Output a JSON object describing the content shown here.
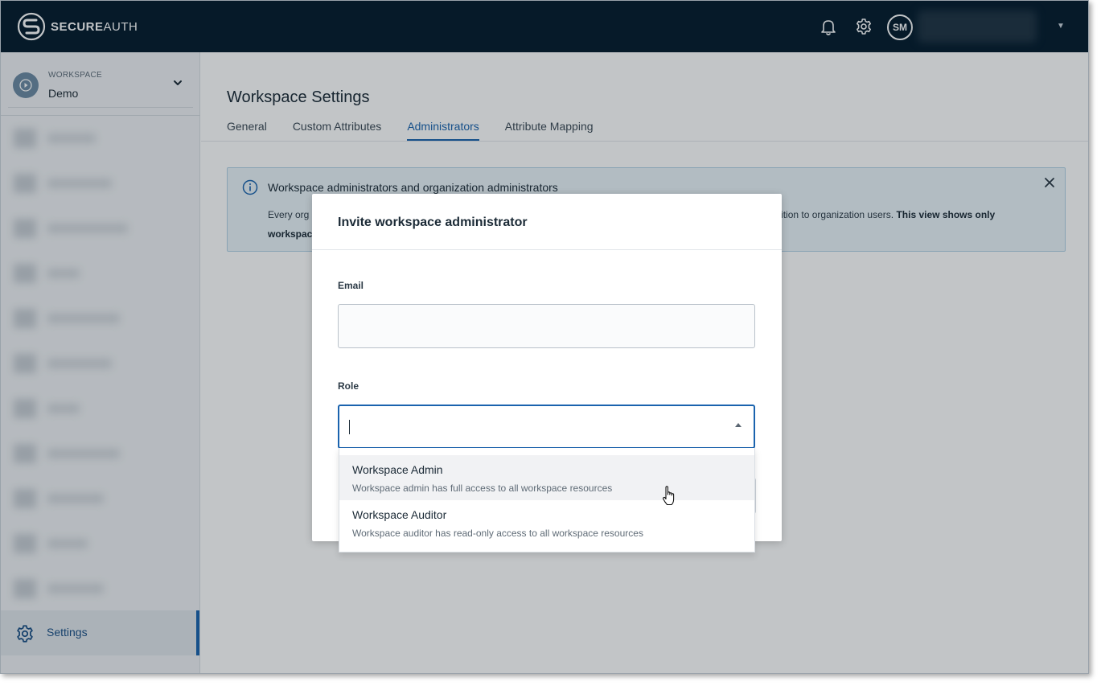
{
  "app": {
    "brand_bold": "SECURE",
    "brand_light": "AUTH",
    "avatar_initials": "SM",
    "icons": {
      "notifications": "bell-icon",
      "settings": "gear-icon",
      "user_menu": "caret-down-icon"
    }
  },
  "sidebar": {
    "workspace_label": "WORKSPACE",
    "workspace_value": "Demo",
    "settings_label": "Settings"
  },
  "main": {
    "title": "Workspace Settings",
    "tabs": [
      {
        "label": "General",
        "active": false
      },
      {
        "label": "Custom Attributes",
        "active": false
      },
      {
        "label": "Administrators",
        "active": true
      },
      {
        "label": "Attribute Mapping",
        "active": false
      }
    ],
    "banner": {
      "title": "Workspace administrators and organization administrators",
      "text_start": "Every org",
      "text_end": "dition to organization users.",
      "text_bold": "This view shows only",
      "text_line2": "workspac"
    }
  },
  "modal": {
    "title": "Invite workspace administrator",
    "email_label": "Email",
    "email_value": "",
    "role_label": "Role",
    "role_value": "",
    "options": [
      {
        "label": "Workspace Admin",
        "description": "Workspace admin has full access to all workspace resources"
      },
      {
        "label": "Workspace Auditor",
        "description": "Workspace auditor has read-only access to all workspace resources"
      }
    ]
  },
  "colors": {
    "topbar": "#041b2d",
    "accent": "#1a63ae",
    "sidebar_bg": "#eff1f4",
    "banner_bg": "#eaf3f9"
  }
}
